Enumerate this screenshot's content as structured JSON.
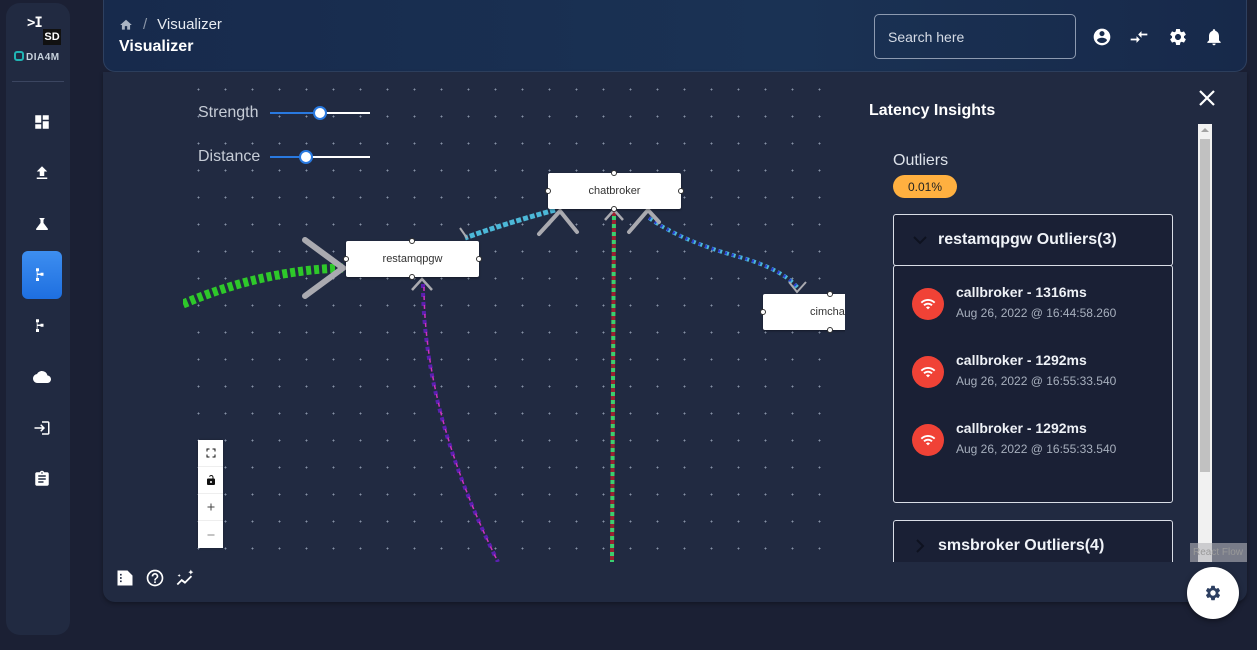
{
  "sidebar": {
    "logo_text": "SD",
    "brand": "DIA4M",
    "items": [
      {
        "icon": "dashboard-icon"
      },
      {
        "icon": "upload-icon"
      },
      {
        "icon": "flask-icon"
      },
      {
        "icon": "hierarchy-icon",
        "active": true
      },
      {
        "icon": "hierarchy-icon"
      },
      {
        "icon": "cloud-icon"
      },
      {
        "icon": "login-icon"
      },
      {
        "icon": "clipboard-icon"
      }
    ]
  },
  "header": {
    "breadcrumb": [
      "Visualizer"
    ],
    "title": "Visualizer",
    "search_placeholder": "Search here"
  },
  "canvas": {
    "sliders": [
      {
        "label": "Strength",
        "value": 0.5
      },
      {
        "label": "Distance",
        "value": 0.36
      }
    ],
    "nodes": [
      {
        "id": "chatbroker",
        "label": "chatbroker"
      },
      {
        "id": "restamqpgw",
        "label": "restamqpgw"
      },
      {
        "id": "cimchat",
        "label": "cimcha"
      }
    ],
    "edge_colors": {
      "green": "#2ec82a",
      "cyan": "#4cb8d8",
      "blue": "#2a3ad0",
      "purple": "#5a20b0",
      "magenta": "#d030c0",
      "redgreen_a": "#9b2030",
      "redgreen_b": "#3ad070"
    }
  },
  "insights": {
    "title": "Latency Insights",
    "outliers_label": "Outliers",
    "outliers_pct": "0.01%",
    "groups": [
      {
        "title": "restamqpgw Outliers(3)",
        "expanded": true,
        "items": [
          {
            "title": "callbroker - 1316ms",
            "time": "Aug 26, 2022 @ 16:44:58.260"
          },
          {
            "title": "callbroker - 1292ms",
            "time": "Aug 26, 2022 @ 16:55:33.540"
          },
          {
            "title": "callbroker - 1292ms",
            "time": "Aug 26, 2022 @ 16:55:33.540"
          }
        ]
      },
      {
        "title": "smsbroker Outliers(4)",
        "expanded": false
      }
    ]
  },
  "attribution": "React Flow",
  "colors": {
    "accent": "#2979e0",
    "badge": "#ffb040",
    "alert": "#f04236"
  }
}
